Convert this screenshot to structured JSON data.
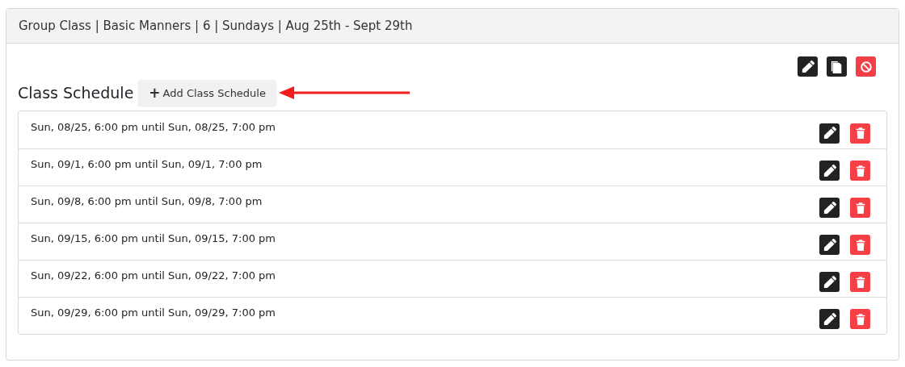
{
  "panel": {
    "title": "Group Class | Basic Manners | 6 | Sundays | Aug 25th - Sept 29th"
  },
  "schedule": {
    "heading": "Class Schedule",
    "add_button": {
      "icon": "+",
      "label": "Add Class Schedule"
    },
    "rows": [
      {
        "text": "Sun, 08/25, 6:00 pm until Sun, 08/25, 7:00 pm"
      },
      {
        "text": "Sun, 09/1, 6:00 pm until Sun, 09/1, 7:00 pm"
      },
      {
        "text": "Sun, 09/8, 6:00 pm until Sun, 09/8, 7:00 pm"
      },
      {
        "text": "Sun, 09/15, 6:00 pm until Sun, 09/15, 7:00 pm"
      },
      {
        "text": "Sun, 09/22, 6:00 pm until Sun, 09/22, 7:00 pm"
      },
      {
        "text": "Sun, 09/29, 6:00 pm until Sun, 09/29, 7:00 pm"
      }
    ]
  }
}
